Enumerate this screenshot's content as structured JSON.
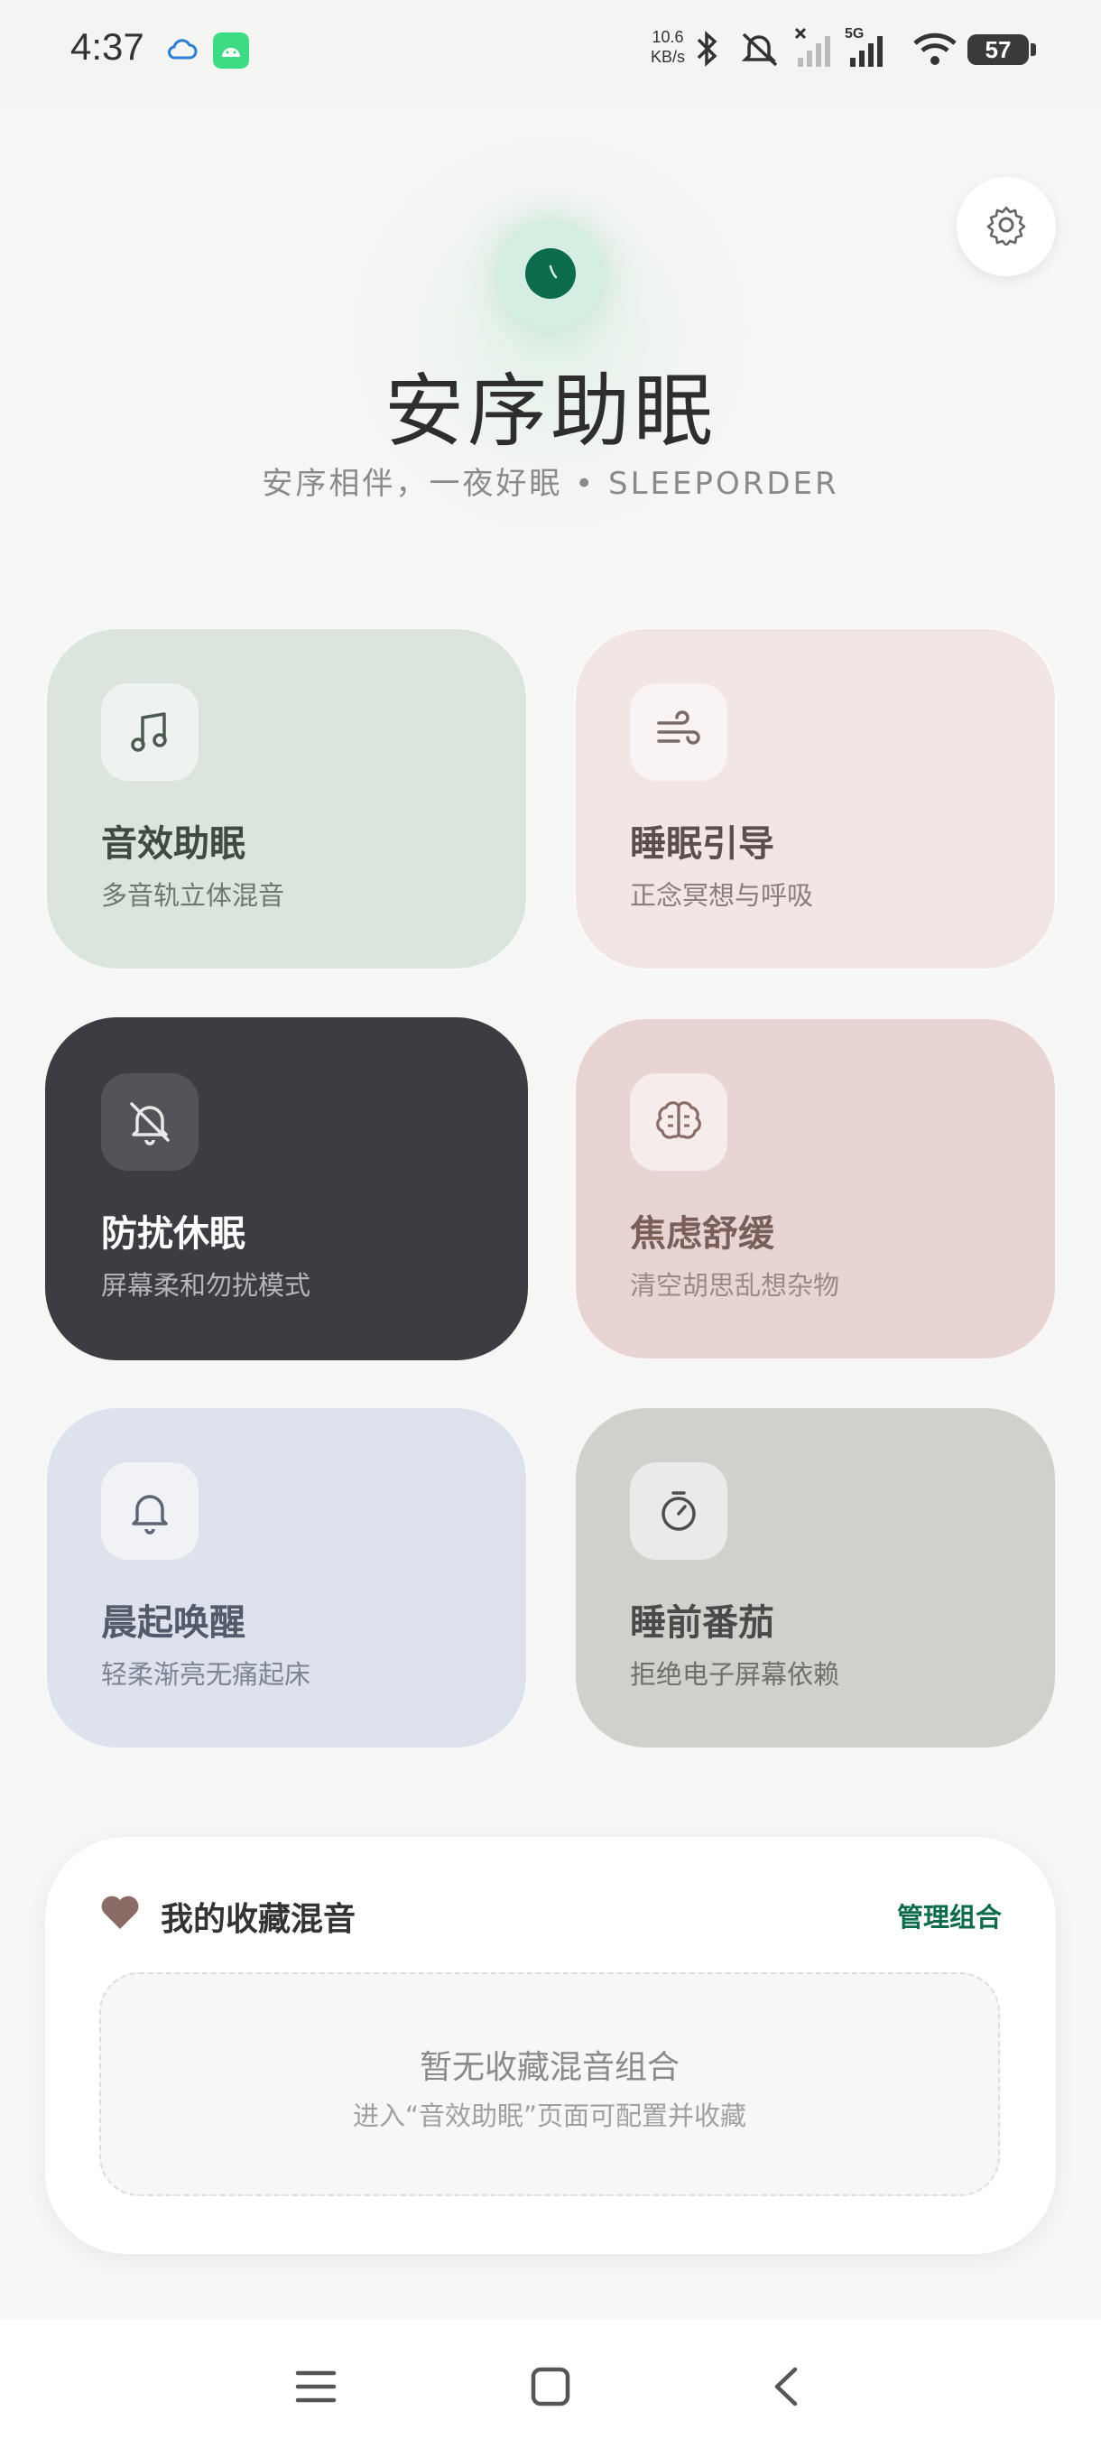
{
  "status_bar": {
    "time": "4:37",
    "net_speed_value": "10.6",
    "net_speed_unit": "KB/s",
    "network_type": "5G",
    "battery": "57"
  },
  "header": {
    "title": "安序助眠",
    "subtitle": "安序相伴，一夜好眠 • SLEEPORDER"
  },
  "cards": [
    {
      "title": "音效助眠",
      "subtitle": "多音轨立体混音",
      "icon": "music-note-icon",
      "bg": "#dce5dd"
    },
    {
      "title": "睡眠引导",
      "subtitle": "正念冥想与呼吸",
      "icon": "wind-icon",
      "bg": "#f1e6e4"
    },
    {
      "title": "防扰休眠",
      "subtitle": "屏幕柔和勿扰模式",
      "icon": "bell-off-icon",
      "bg": "#3b3d42"
    },
    {
      "title": "焦虑舒缓",
      "subtitle": "清空胡思乱想杂物",
      "icon": "brain-icon",
      "bg": "#e8d5d3"
    },
    {
      "title": "晨起唤醒",
      "subtitle": "轻柔渐亮无痛起床",
      "icon": "bell-icon",
      "bg": "#dde2ec"
    },
    {
      "title": "睡前番茄",
      "subtitle": "拒绝电子屏幕依赖",
      "icon": "timer-icon",
      "bg": "#d0d1cd"
    }
  ],
  "favorites": {
    "title": "我的收藏混音",
    "manage_label": "管理组合",
    "empty_title": "暂无收藏混音组合",
    "empty_desc": "进入“音效助眠”页面可配置并收藏"
  },
  "colors": {
    "accent": "#0d6b4d",
    "heart": "#8a6b66"
  }
}
